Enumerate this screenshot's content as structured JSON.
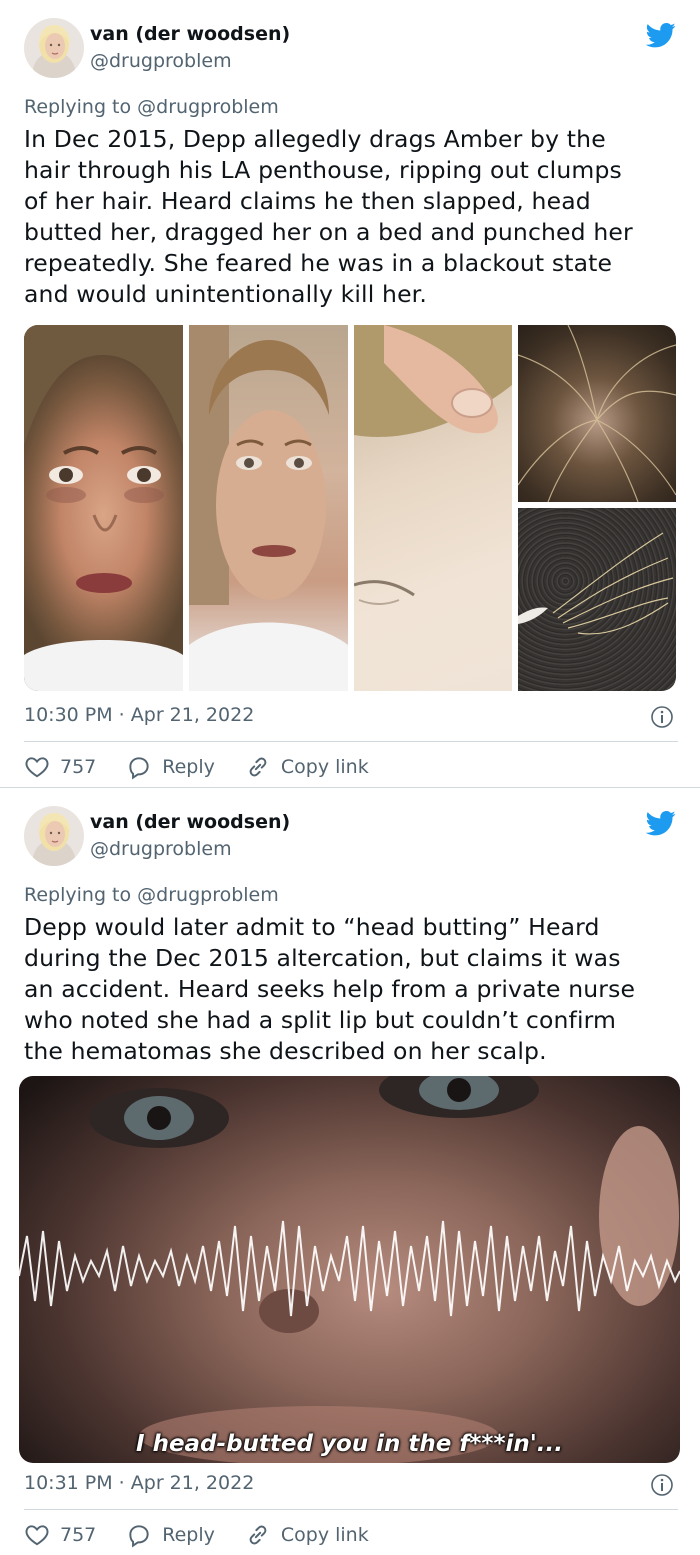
{
  "tweets": [
    {
      "author_name": "van (der woodsen)",
      "author_handle": "@drugproblem",
      "replying_to": "Replying to @drugproblem",
      "text_lines": [
        "In Dec 2015, Depp allegedly drags Amber by the",
        "hair through his LA penthouse, ripping out clumps",
        "of her hair. Heard claims he then slapped, head",
        "butted her, dragged her on a bed and punched her",
        "repeatedly. She feared he was in a blackout state",
        "and would unintentionally kill her."
      ],
      "timestamp": "10:30 PM · Apr 21, 2022",
      "likes": "757",
      "reply_label": "Reply",
      "copy_link_label": "Copy link"
    },
    {
      "author_name": "van (der woodsen)",
      "author_handle": "@drugproblem",
      "replying_to": "Replying to @drugproblem",
      "text_lines": [
        "Depp would later admit to “head butting” Heard",
        "during the Dec 2015 altercation, but claims it was",
        "an accident. Heard seeks help from a private nurse",
        "who noted she had a split lip but couldn’t confirm",
        "the hematomas she described on her scalp."
      ],
      "image_caption": "I head-butted you in the f***in'...",
      "timestamp": "10:31 PM · Apr 21, 2022",
      "likes": "757",
      "reply_label": "Reply",
      "copy_link_label": "Copy link"
    }
  ],
  "icons": {
    "brand": "twitter-bird-icon",
    "like": "heart-icon",
    "reply": "reply-bubble-icon",
    "copy_link": "link-icon",
    "info": "info-icon"
  },
  "colors": {
    "twitter_blue": "#1d9bf0",
    "text": "#0f1419",
    "muted": "#536471",
    "border": "#cfd9de"
  }
}
